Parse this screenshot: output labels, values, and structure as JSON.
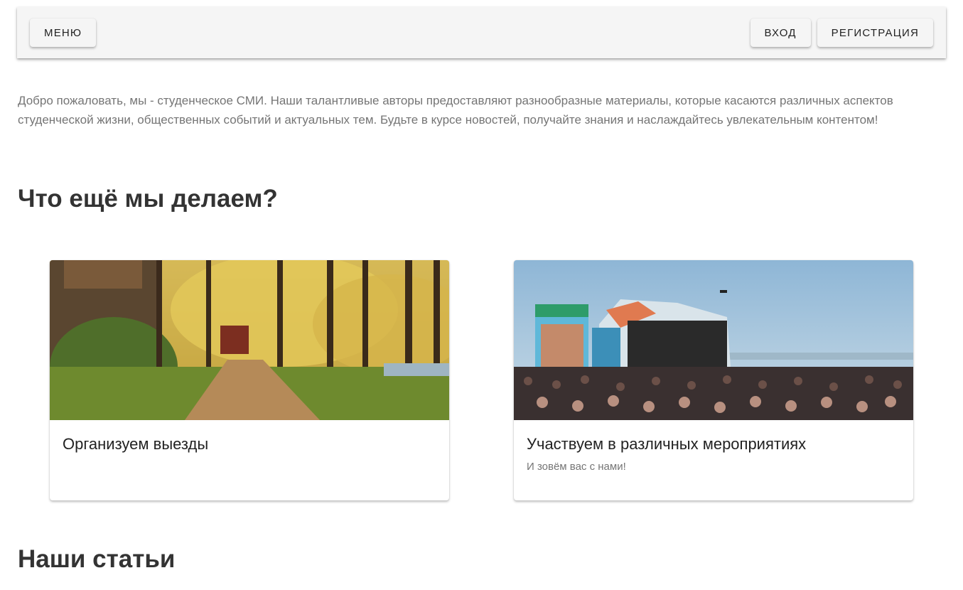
{
  "header": {
    "menu_label": "МЕНЮ",
    "login_label": "ВХОД",
    "register_label": "РЕГИСТРАЦИЯ"
  },
  "intro": {
    "text": "Добро пожаловать, мы - студенческое СМИ. Наши талантливые авторы предоставляют разнообразные материалы, которые касаются различных аспектов студенческой жизни, общественных событий и актуальных тем. Будьте в курсе новостей, получайте знания и наслаждайтесь увлекательным контентом!"
  },
  "sections": {
    "what_we_do": "Что ещё мы делаем?",
    "articles": "Наши статьи"
  },
  "cards": [
    {
      "title": "Организуем выезды",
      "subtitle": "",
      "image": "autumn-forest-photo"
    },
    {
      "title": "Участвуем в различных мероприятиях",
      "subtitle": "И зовём вас с нами!",
      "image": "festival-crowd-photo"
    }
  ],
  "colors": {
    "topbar": "#f5f5f5",
    "text_muted": "#757575",
    "heading": "#333333"
  }
}
